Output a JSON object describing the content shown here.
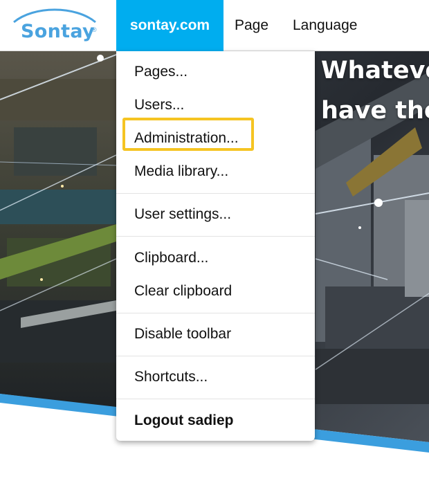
{
  "logo": {
    "text": "Sontay",
    "mark": "®"
  },
  "toolbar": {
    "site_tab": "sontay.com",
    "page_tab": "Page",
    "language_tab": "Language"
  },
  "hero": {
    "headline_line1": "Whateve",
    "headline_line2": "have the"
  },
  "menu": {
    "pages": "Pages...",
    "users": "Users...",
    "administration": "Administration...",
    "media_library": "Media library...",
    "user_settings": "User settings...",
    "clipboard": "Clipboard...",
    "clear_clipboard": "Clear clipboard",
    "disable_toolbar": "Disable toolbar",
    "shortcuts": "Shortcuts...",
    "logout": "Logout sadiep"
  },
  "colors": {
    "brand_blue": "#4aa3df",
    "active_tab": "#00adef",
    "highlight": "#f5c422"
  }
}
